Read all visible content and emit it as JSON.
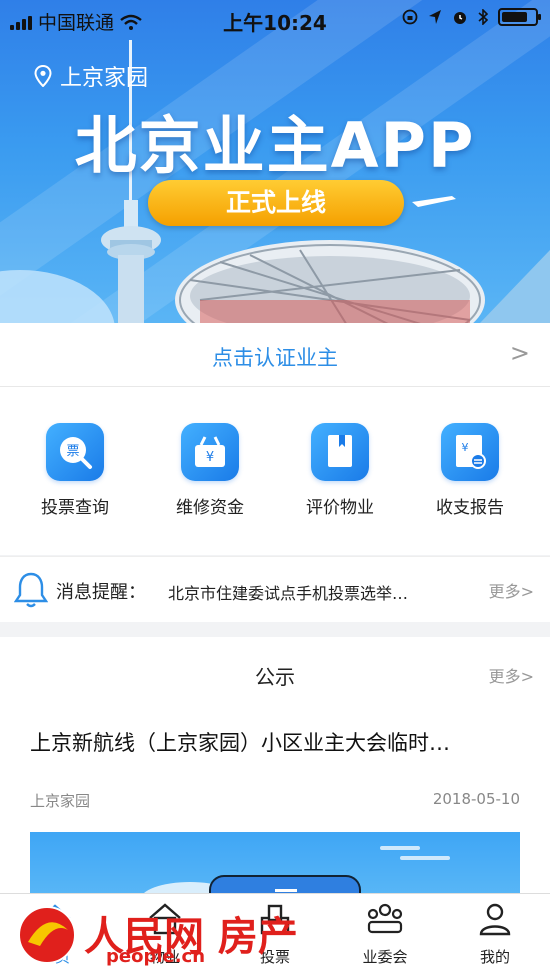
{
  "status_bar": {
    "carrier": "中国联通",
    "time": "上午10:24"
  },
  "banner": {
    "location": "上京家园",
    "title": "北京业主APP",
    "launch_label": "正式上线"
  },
  "auth": {
    "label": "点击认证业主",
    "chevron": ">"
  },
  "services": [
    {
      "label": "投票查询",
      "icon": "ticket-search-icon"
    },
    {
      "label": "维修资金",
      "icon": "money-box-icon"
    },
    {
      "label": "评价物业",
      "icon": "book-bookmark-icon"
    },
    {
      "label": "收支报告",
      "icon": "yuan-report-icon"
    }
  ],
  "notice": {
    "label": "消息提醒：",
    "text": "北京市住建委试点手机投票选举…",
    "more": "更多>"
  },
  "public": {
    "heading": "公示",
    "more": "更多>",
    "article": {
      "title": "上京新航线（上京家园）小区业主大会临时…",
      "source": "上京家园",
      "date": "2018-05-10"
    }
  },
  "tabbar": [
    {
      "label": "首页",
      "icon": "home-icon",
      "active": true
    },
    {
      "label": "物业",
      "icon": "building-icon"
    },
    {
      "label": "投票",
      "icon": "ballot-box-icon"
    },
    {
      "label": "业委会",
      "icon": "group-icon"
    },
    {
      "label": "我的",
      "icon": "user-icon"
    }
  ],
  "watermark": {
    "text": "人民网 房产",
    "sub": "people.cn"
  },
  "colors": {
    "accent": "#2d8ee6",
    "banner": "#3a9bf0",
    "launch": "#f5a000",
    "watermark": "#e0201c"
  }
}
